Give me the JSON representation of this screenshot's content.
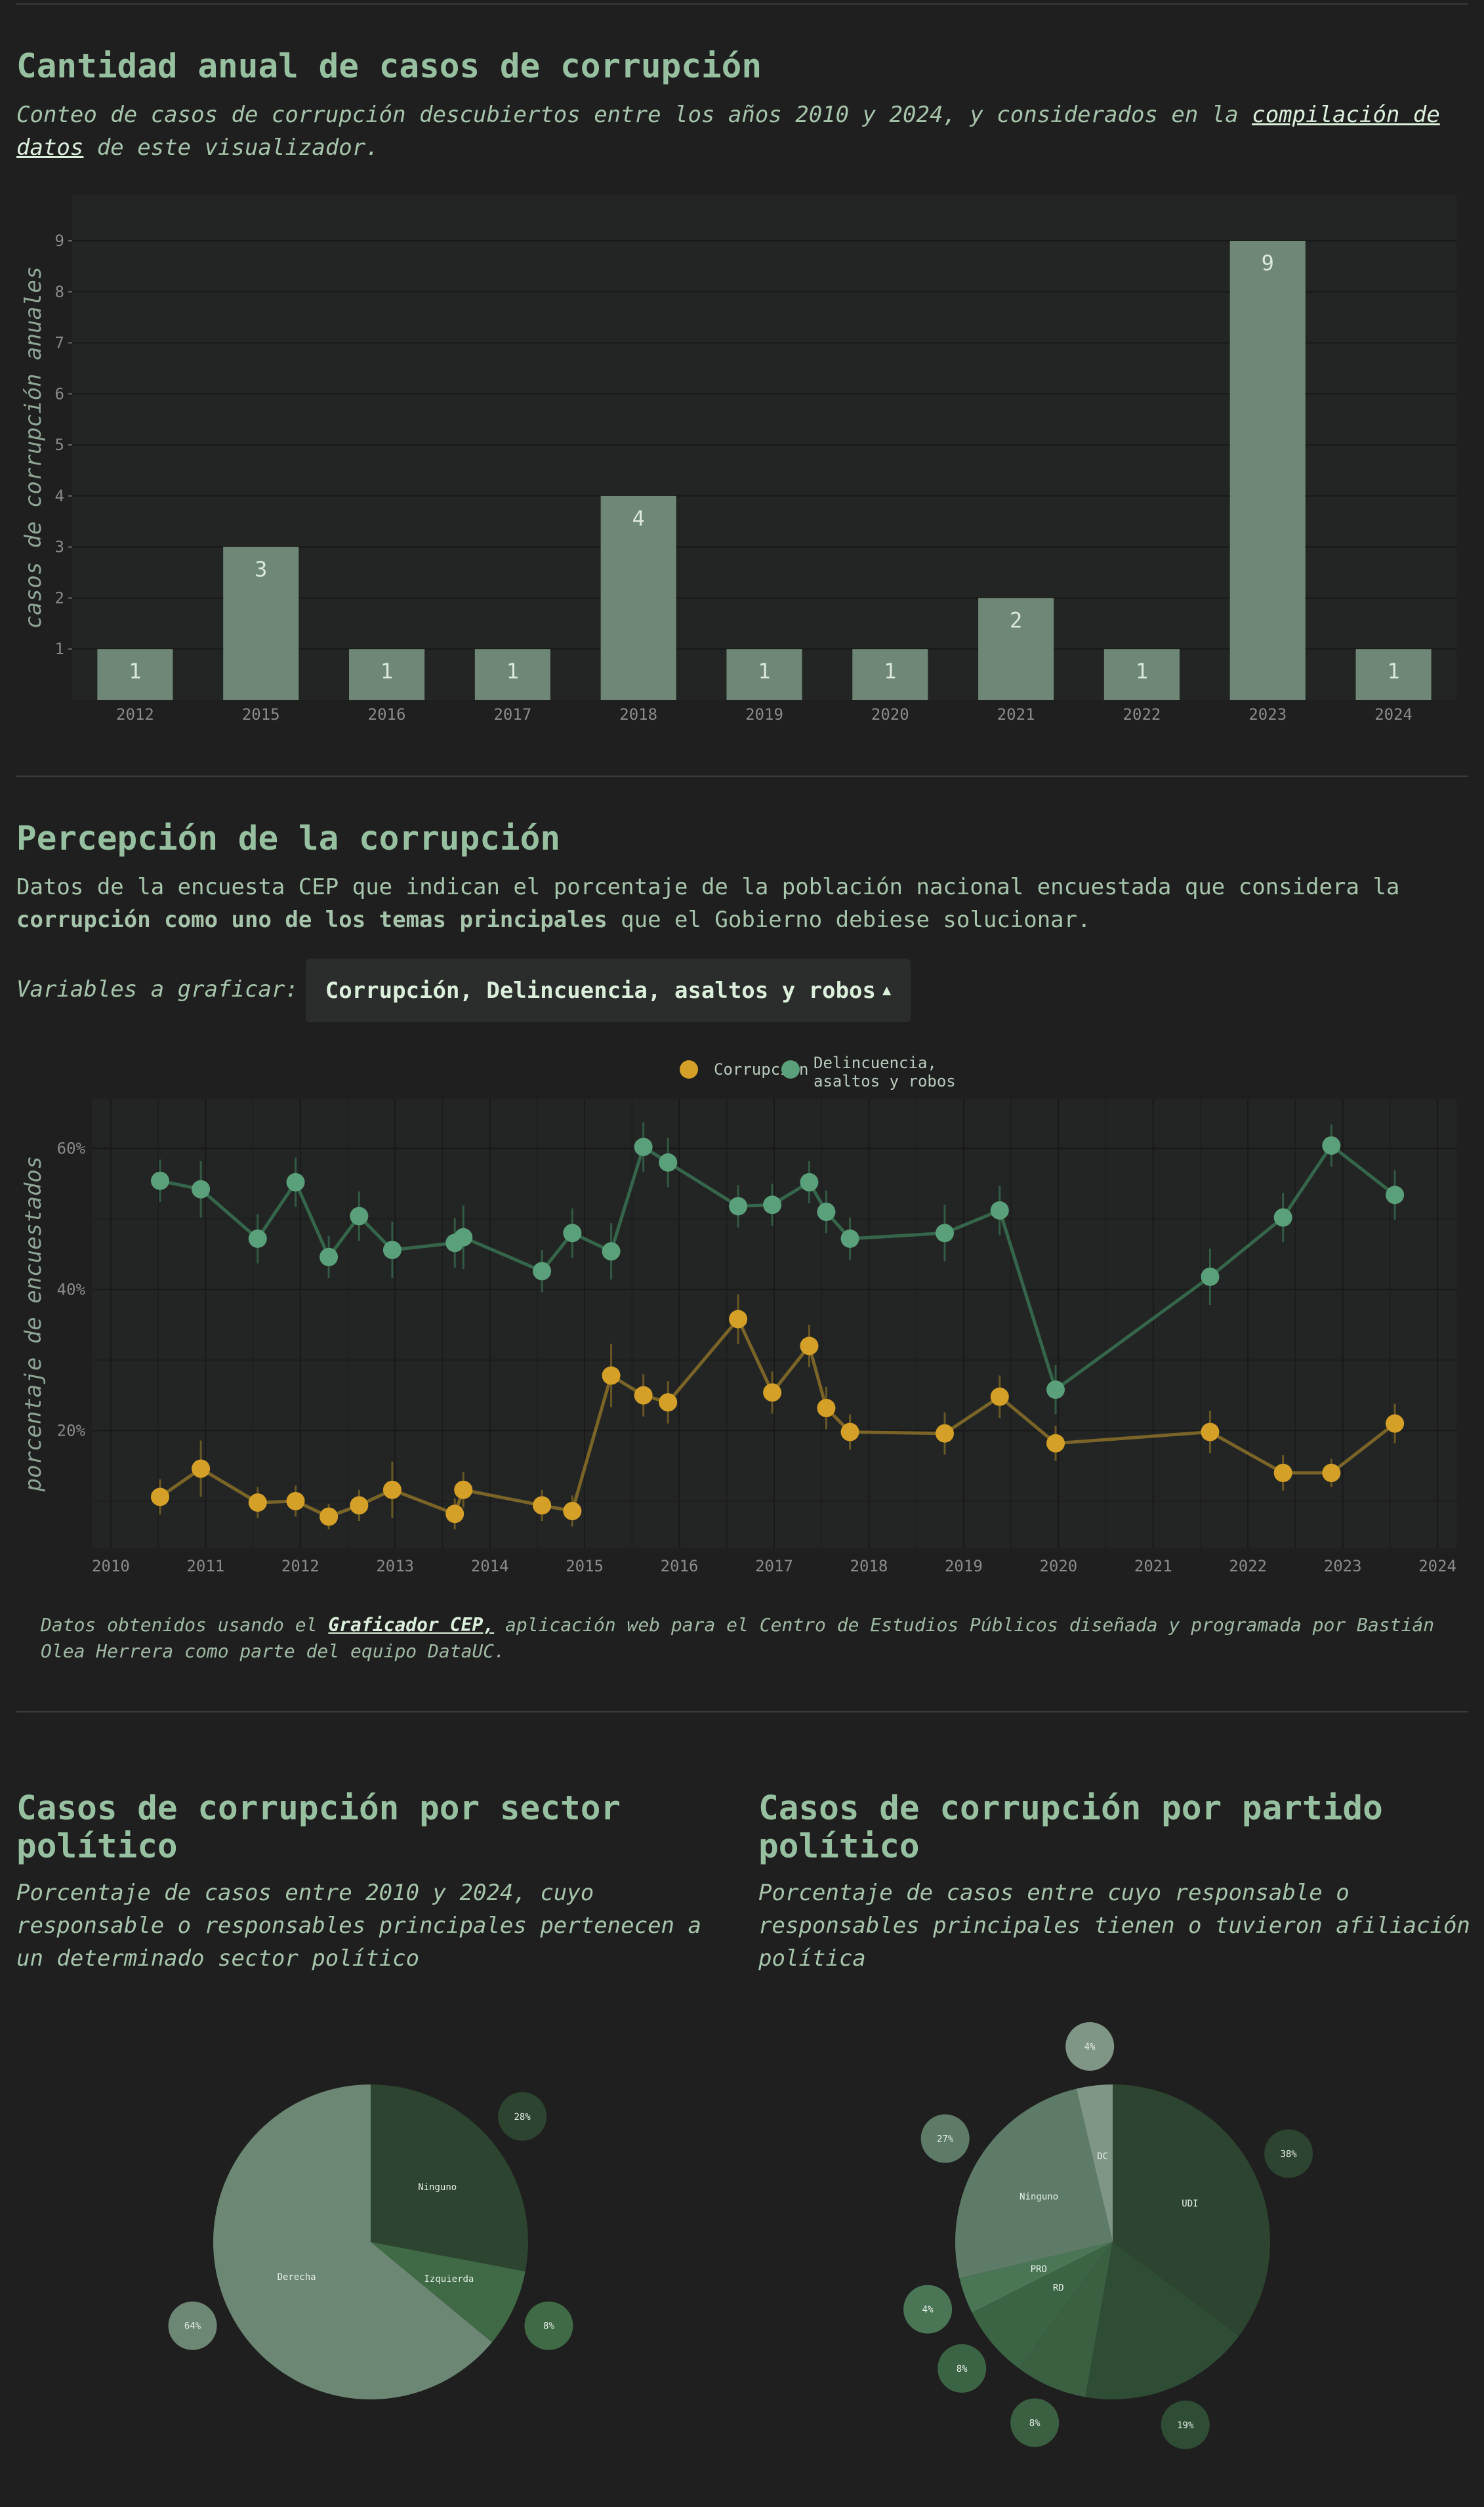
{
  "colors": {
    "background": "#1f1f1f",
    "panel": "#232524",
    "bar": "#6e8776",
    "accent_text": "#97c0a0",
    "corrupcion": "#d4a027",
    "delincuencia": "#5aa07a",
    "pie_dark": "#2c4430",
    "pie_mid": "#3f6a45",
    "pie_light": "#6c8774"
  },
  "section1": {
    "title": "Cantidad anual de casos de corrupción",
    "desc_a": "Conteo de casos de corrupción descubiertos entre los años 2010 y 2024, y considerados en la ",
    "desc_link": "compilación de datos",
    "desc_b": " de este visualizador."
  },
  "section2": {
    "title": "Percepción de la corrupción",
    "desc_a": "Datos de la encuesta CEP que indican el porcentaje de la población nacional encuestada que considera la ",
    "desc_bold": "corrupción como uno de los temas principales",
    "desc_b": " que el Gobierno debiese solucionar.",
    "selector_label": "Variables a graficar:",
    "selector_value": "Corrupción, Delincuencia, asaltos y robos",
    "selector_icon": "caret-up-icon",
    "footnote_a": "Datos obtenidos usando el ",
    "footnote_link": "Graficador CEP,",
    "footnote_b": " aplicación web para el Centro de Estudios Públicos diseñada y programada por Bastián Olea Herrera como parte del equipo DataUC."
  },
  "section3": {
    "title": "Casos de corrupción por sector político",
    "desc": "Porcentaje de casos entre 2010 y 2024, cuyo responsable o responsables principales pertenecen a un determinado sector político"
  },
  "section4": {
    "title": "Casos de corrupción por partido político",
    "desc": "Porcentaje de casos entre cuyo responsable o responsables principales tienen o tuvieron afiliación política"
  },
  "chart_data": [
    {
      "type": "bar",
      "ylabel": "casos de corrupción anuales",
      "categories": [
        "2012",
        "2015",
        "2016",
        "2017",
        "2018",
        "2019",
        "2020",
        "2021",
        "2022",
        "2023",
        "2024"
      ],
      "values": [
        1,
        3,
        1,
        1,
        4,
        1,
        1,
        2,
        1,
        9,
        1
      ],
      "yticks": [
        1,
        2,
        3,
        4,
        5,
        6,
        7,
        8,
        9
      ],
      "ylim": [
        0,
        9.9
      ],
      "grid": true
    },
    {
      "type": "line",
      "ylabel": "porcentaje de encuestados",
      "xlim": [
        2009.8,
        2024.2
      ],
      "ylim": [
        0.033,
        0.67
      ],
      "xticks": [
        "2010",
        "2011",
        "2012",
        "2013",
        "2014",
        "2015",
        "2016",
        "2017",
        "2018",
        "2019",
        "2020",
        "2021",
        "2022",
        "2023",
        "2024"
      ],
      "yticks": [
        "20%",
        "40%",
        "60%"
      ],
      "legend": "top-center",
      "series": [
        {
          "name": "Corrupción",
          "x": [
            2010.52,
            2010.95,
            2011.55,
            2011.95,
            2012.3,
            2012.62,
            2012.97,
            2013.63,
            2013.72,
            2014.55,
            2014.87,
            2015.28,
            2015.62,
            2015.88,
            2016.62,
            2016.98,
            2017.37,
            2017.55,
            2017.8,
            2018.8,
            2019.38,
            2019.97,
            2021.6,
            2022.37,
            2022.88,
            2023.55
          ],
          "y": [
            0.106,
            0.146,
            0.098,
            0.1,
            0.078,
            0.094,
            0.116,
            0.082,
            0.116,
            0.094,
            0.086,
            0.278,
            0.25,
            0.24,
            0.358,
            0.254,
            0.32,
            0.232,
            0.198,
            0.196,
            0.248,
            0.182,
            0.198,
            0.14,
            0.14,
            0.21
          ],
          "err": [
            0.025,
            0.04,
            0.022,
            0.022,
            0.018,
            0.022,
            0.04,
            0.022,
            0.025,
            0.022,
            0.022,
            0.045,
            0.03,
            0.03,
            0.035,
            0.03,
            0.03,
            0.03,
            0.025,
            0.03,
            0.03,
            0.025,
            0.03,
            0.025,
            0.02,
            0.028
          ]
        },
        {
          "name": "Delincuencia, asaltos y robos",
          "x": [
            2010.52,
            2010.95,
            2011.55,
            2011.95,
            2012.3,
            2012.62,
            2012.97,
            2013.63,
            2013.72,
            2014.55,
            2014.87,
            2015.28,
            2015.62,
            2015.88,
            2016.62,
            2016.98,
            2017.37,
            2017.55,
            2017.8,
            2018.8,
            2019.38,
            2019.97,
            2021.6,
            2022.37,
            2022.88,
            2023.55
          ],
          "y": [
            0.554,
            0.542,
            0.472,
            0.552,
            0.446,
            0.504,
            0.456,
            0.466,
            0.474,
            0.426,
            0.48,
            0.454,
            0.602,
            0.58,
            0.518,
            0.52,
            0.552,
            0.51,
            0.472,
            0.48,
            0.512,
            0.258,
            0.418,
            0.502,
            0.604,
            0.534
          ],
          "err": [
            0.03,
            0.04,
            0.035,
            0.035,
            0.03,
            0.035,
            0.04,
            0.035,
            0.045,
            0.03,
            0.035,
            0.04,
            0.035,
            0.035,
            0.03,
            0.03,
            0.03,
            0.03,
            0.03,
            0.04,
            0.035,
            0.035,
            0.04,
            0.035,
            0.03,
            0.035
          ]
        }
      ]
    },
    {
      "type": "pie",
      "slices": [
        {
          "label": "Ninguno",
          "value": 28,
          "pct": "28%",
          "color": "#2c4430"
        },
        {
          "label": "Izquierda",
          "value": 8,
          "pct": "8%",
          "color": "#3f6a45"
        },
        {
          "label": "Derecha",
          "value": 64,
          "pct": "64%",
          "color": "#6c8774"
        }
      ]
    },
    {
      "type": "pie",
      "slices": [
        {
          "label": "UDI",
          "value": 38,
          "pct": "38%",
          "color": "#2c4430"
        },
        {
          "label": "",
          "value": 19,
          "pct": "19%",
          "color": "#2f4d35"
        },
        {
          "label": "",
          "value": 8,
          "pct": "8%",
          "color": "#3a5f41"
        },
        {
          "label": "RD",
          "value": 8,
          "pct": "8%",
          "color": "#3b6444"
        },
        {
          "label": "PRO",
          "value": 4,
          "pct": "4%",
          "color": "#4a7656"
        },
        {
          "label": "Ninguno",
          "value": 27,
          "pct": "27%",
          "color": "#5d7b67"
        },
        {
          "label": "DC",
          "value": 4,
          "pct": "4%",
          "color": "#7f9586"
        }
      ]
    }
  ]
}
